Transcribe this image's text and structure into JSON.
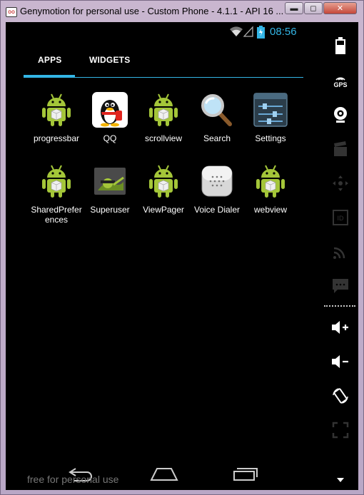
{
  "window": {
    "title": "Genymotion for personal use - Custom Phone - 4.1.1 - API 16 ...",
    "app_icon": "oo",
    "minimize": "▬",
    "maximize": "◻",
    "close": "✕"
  },
  "status_bar": {
    "time": "08:56",
    "icons": [
      "wifi-icon",
      "signal-icon",
      "battery-charging-icon"
    ]
  },
  "tabs": [
    {
      "label": "APPS",
      "selected": true
    },
    {
      "label": "WIDGETS",
      "selected": false
    }
  ],
  "apps": [
    {
      "label": "progressbar",
      "icon": "android-robot-icon"
    },
    {
      "label": "QQ",
      "icon": "qq-penguin-icon"
    },
    {
      "label": "scrollview",
      "icon": "android-robot-icon"
    },
    {
      "label": "Search",
      "icon": "magnifier-icon"
    },
    {
      "label": "Settings",
      "icon": "settings-sliders-icon"
    },
    {
      "label": "SharedPrefer ences",
      "icon": "android-robot-icon"
    },
    {
      "label": "Superuser",
      "icon": "superuser-android-icon"
    },
    {
      "label": "ViewPager",
      "icon": "android-robot-icon"
    },
    {
      "label": "Voice Dialer",
      "icon": "voice-dialer-icon"
    },
    {
      "label": "webview",
      "icon": "android-robot-icon"
    }
  ],
  "nav": {
    "watermark": "free for personal use",
    "buttons": [
      "back-icon",
      "home-icon",
      "recent-apps-icon"
    ]
  },
  "sidebar": {
    "gps_label": "GPS",
    "icons": [
      "battery-icon",
      "gps-icon",
      "webcam-icon",
      "video-capture-icon",
      "dpad-icon",
      "id-icon",
      "cast-icon",
      "sms-icon",
      "volume-up-icon",
      "volume-down-icon",
      "rotate-icon",
      "fullscreen-icon",
      "scroll-down-icon"
    ]
  },
  "colors": {
    "accent": "#33b5e5",
    "android_green": "#a4c639",
    "screen_bg": "#000000"
  }
}
